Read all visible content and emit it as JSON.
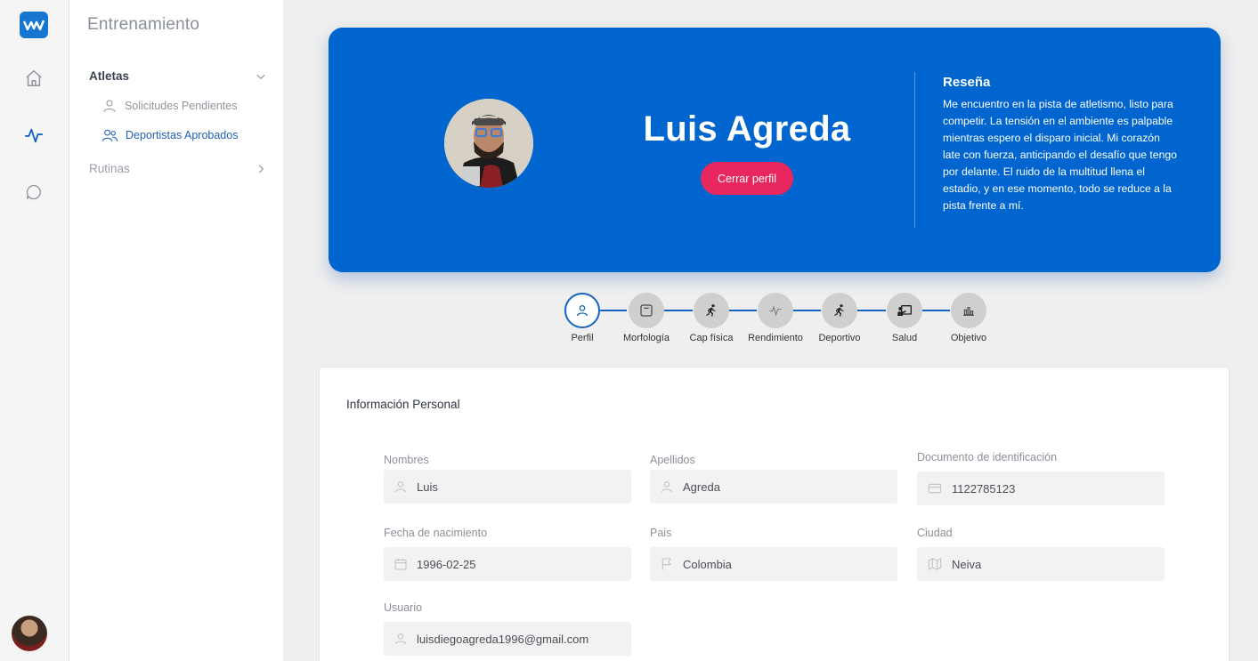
{
  "rail": {
    "icons": [
      "home-icon",
      "activity-icon",
      "chat-icon"
    ],
    "brand_color": "#1676d2"
  },
  "menu": {
    "title": "Entrenamiento",
    "groups": [
      {
        "label": "Atletas",
        "expanded": true,
        "items": [
          {
            "label": "Solicitudes Pendientes",
            "icon": "user-icon",
            "active": false
          },
          {
            "label": "Deportistas Aprobados",
            "icon": "users-icon",
            "active": true
          }
        ]
      },
      {
        "label": "Rutinas",
        "expanded": false
      }
    ]
  },
  "profile": {
    "name": "Luis Agreda",
    "close_button": "Cerrar perfil",
    "bio_title": "Reseña",
    "bio": "Me encuentro en la pista de atletismo, listo para competir. La tensión en el ambiente es palpable mientras espero el disparo inicial. Mi corazón late con fuerza, anticipando el desafío que tengo por delante. El ruido de la multitud llena el estadio, y en ese momento, todo se reduce a la pista frente a mí.",
    "accent": "#0065cf",
    "button_color": "#e8275f"
  },
  "steps": [
    {
      "label": "Perfil",
      "icon": "user-icon",
      "active": true
    },
    {
      "label": "Morfología",
      "icon": "scale-icon",
      "active": false
    },
    {
      "label": "Cap física",
      "icon": "running-icon",
      "active": false
    },
    {
      "label": "Rendimiento",
      "icon": "pulse-icon",
      "active": false
    },
    {
      "label": "Deportivo",
      "icon": "running-icon",
      "active": false
    },
    {
      "label": "Salud",
      "icon": "doctor-icon",
      "active": false
    },
    {
      "label": "Objetivo",
      "icon": "bars-icon",
      "active": false
    }
  ],
  "personal_info": {
    "title": "Información Personal",
    "fields": {
      "nombres": {
        "label": "Nombres",
        "value": "Luis",
        "icon": "user-icon"
      },
      "apellidos": {
        "label": "Apellidos",
        "value": "Agreda",
        "icon": "user-icon"
      },
      "documento": {
        "label": "Documento de identificación",
        "value": "1122785123",
        "icon": "id-card-icon"
      },
      "fecha": {
        "label": "Fecha de nacimiento",
        "value": "1996-02-25",
        "icon": "calendar-icon"
      },
      "pais": {
        "label": "Pais",
        "value": "Colombia",
        "icon": "flag-icon"
      },
      "ciudad": {
        "label": "Ciudad",
        "value": "Neiva",
        "icon": "map-icon"
      },
      "usuario": {
        "label": "Usuario",
        "value": "luisdiegoagreda1996@gmail.com",
        "icon": "user-icon"
      }
    }
  }
}
